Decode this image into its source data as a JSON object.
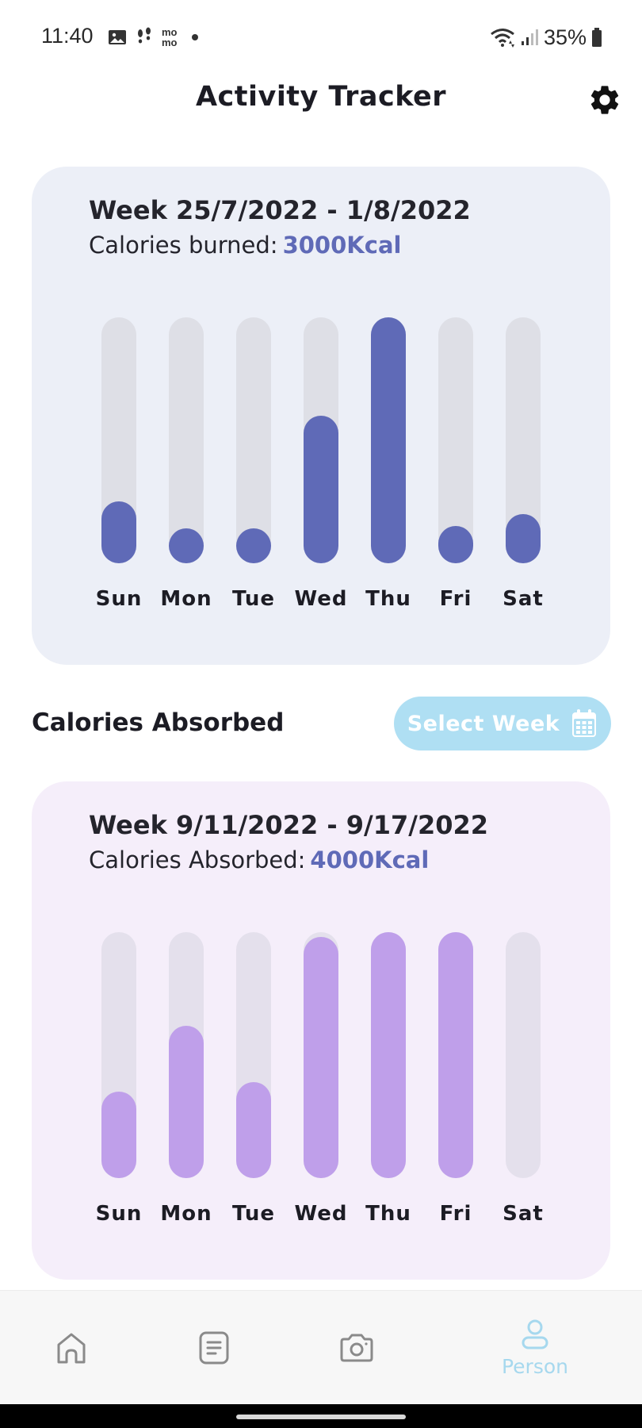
{
  "status_bar": {
    "time": "11:40",
    "momo_top": "mo",
    "momo_bottom": "mo",
    "battery": "35%"
  },
  "header": {
    "title": "Activity Tracker",
    "settings_icon": "gear-icon"
  },
  "burned_card": {
    "week": "Week 25/7/2022 - 1/8/2022",
    "label": "Calories burned:",
    "value": "3000Kcal",
    "fill_color": "#5f6ab7",
    "track_color": "#dedfe6",
    "days": [
      {
        "label": "Sun",
        "level": 0.25
      },
      {
        "label": "Mon",
        "level": 0.14
      },
      {
        "label": "Tue",
        "level": 0.14
      },
      {
        "label": "Wed",
        "level": 0.6
      },
      {
        "label": "Thu",
        "level": 1.0
      },
      {
        "label": "Fri",
        "level": 0.15
      },
      {
        "label": "Sat",
        "level": 0.2
      }
    ]
  },
  "absorbed_section": {
    "title": "Calories Absorbed",
    "select_week_label": "Select Week",
    "calendar_icon": "calendar-icon"
  },
  "absorbed_card": {
    "week": "Week 9/11/2022 - 9/17/2022",
    "label": "Calories Absorbed:",
    "value": "4000Kcal",
    "fill_color": "#bf9fea",
    "track_color": "#e4e0ec",
    "days": [
      {
        "label": "Sun",
        "level": 0.35
      },
      {
        "label": "Mon",
        "level": 0.62
      },
      {
        "label": "Tue",
        "level": 0.39
      },
      {
        "label": "Wed",
        "level": 0.98
      },
      {
        "label": "Thu",
        "level": 1.0
      },
      {
        "label": "Fri",
        "level": 1.0
      },
      {
        "label": "Sat",
        "level": 0.0
      }
    ]
  },
  "bottom_nav": {
    "items": [
      {
        "icon": "home-icon",
        "label": ""
      },
      {
        "icon": "document-icon",
        "label": ""
      },
      {
        "icon": "camera-icon",
        "label": ""
      },
      {
        "icon": "person-icon",
        "label": "Person",
        "active": true
      }
    ],
    "active_color": "#a6d8ee",
    "inactive_color": "#8a8a8a"
  }
}
